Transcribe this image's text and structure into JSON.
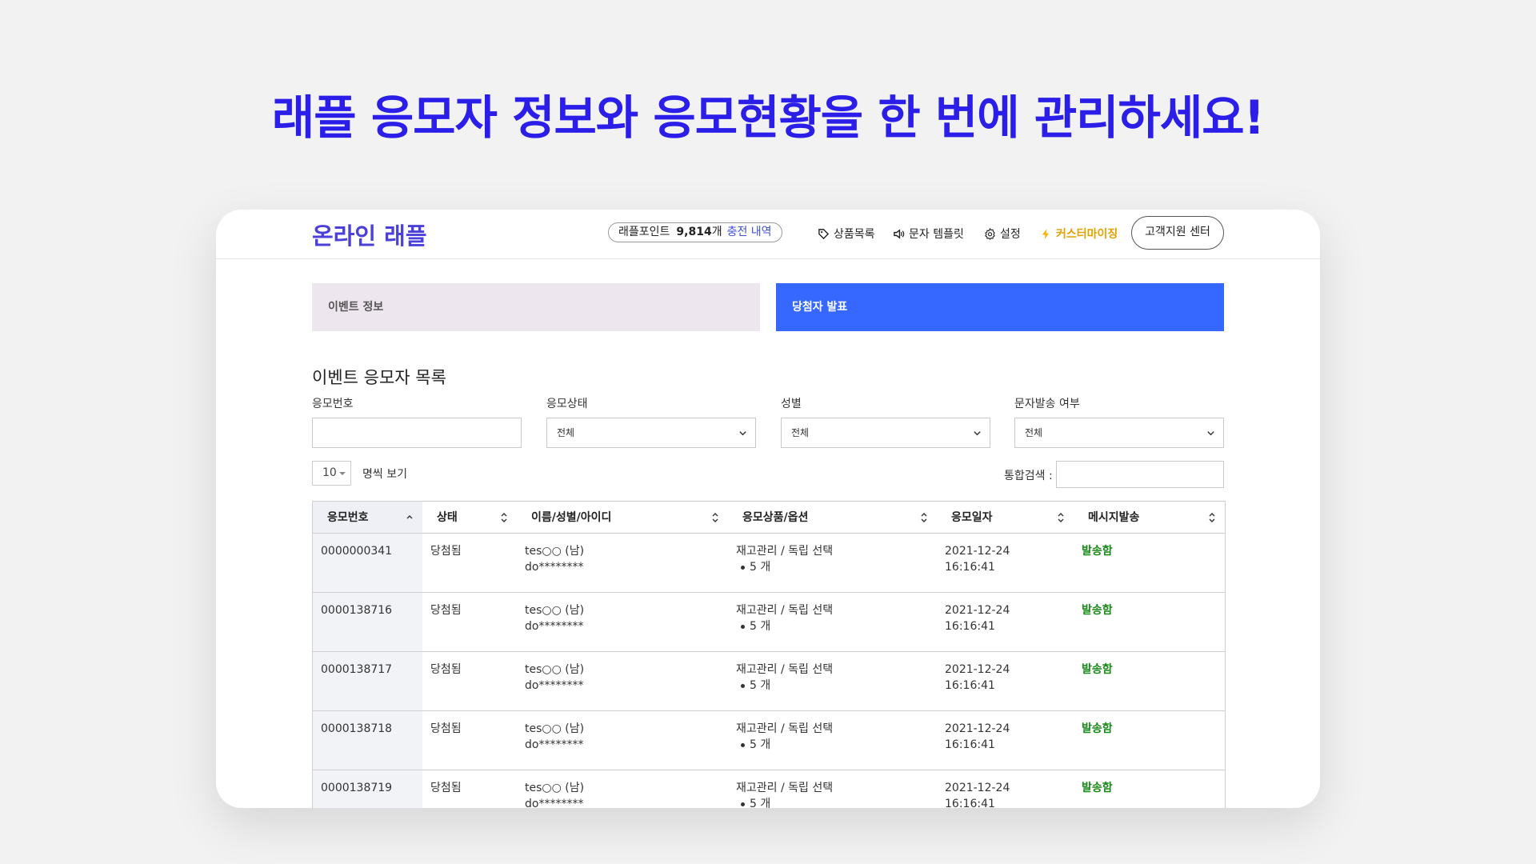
{
  "headline": "래플 응모자 정보와 응모현황을 한 번에 관리하세요!",
  "app": {
    "logo": "온라인 래플",
    "points_label": "래플포인트",
    "points_value": "9,814",
    "points_unit": "개",
    "points_link": "충전 내역",
    "nav": {
      "products": "상품목록",
      "sms_template": "문자 템플릿",
      "settings": "설정",
      "customize": "커스터마이징"
    },
    "support_button": "고객지원 센터",
    "accent_color": "#3668ff",
    "brand_color": "#4b40d9"
  },
  "tabs": {
    "event_info": "이벤트 정보",
    "winner_announce": "당첨자 발표"
  },
  "section_title": "이벤트 응모자 목록",
  "filters": {
    "entry_no_label": "응모번호",
    "entry_no_value": "",
    "status_label": "응모상태",
    "status_value": "전체",
    "gender_label": "성별",
    "gender_value": "전체",
    "sms_label": "문자발송 여부",
    "sms_value": "전체"
  },
  "list_controls": {
    "page_size": "10",
    "page_size_label": "명씩 보기",
    "search_label": "통합검색 :",
    "search_value": ""
  },
  "table": {
    "headers": [
      "응모번호",
      "상태",
      "이름/성별/아이디",
      "응모상품/옵션",
      "응모일자",
      "메시지발송"
    ],
    "rows": [
      {
        "id": "0000000341",
        "status": "당첨됨",
        "name": "tes○○ (남)",
        "user": "do********",
        "product": "재고관리 / 독립 선택",
        "qty": "5 개",
        "date": "2021-12-24",
        "time": "16:16:41",
        "sms": "발송함"
      },
      {
        "id": "0000138716",
        "status": "당첨됨",
        "name": "tes○○ (남)",
        "user": "do********",
        "product": "재고관리 / 독립 선택",
        "qty": "5 개",
        "date": "2021-12-24",
        "time": "16:16:41",
        "sms": "발송함"
      },
      {
        "id": "0000138717",
        "status": "당첨됨",
        "name": "tes○○ (남)",
        "user": "do********",
        "product": "재고관리 / 독립 선택",
        "qty": "5 개",
        "date": "2021-12-24",
        "time": "16:16:41",
        "sms": "발송함"
      },
      {
        "id": "0000138718",
        "status": "당첨됨",
        "name": "tes○○ (남)",
        "user": "do********",
        "product": "재고관리 / 독립 선택",
        "qty": "5 개",
        "date": "2021-12-24",
        "time": "16:16:41",
        "sms": "발송함"
      },
      {
        "id": "0000138719",
        "status": "당첨됨",
        "name": "tes○○ (남)",
        "user": "do********",
        "product": "재고관리 / 독립 선택",
        "qty": "5 개",
        "date": "2021-12-24",
        "time": "16:16:41",
        "sms": "발송함"
      }
    ]
  }
}
